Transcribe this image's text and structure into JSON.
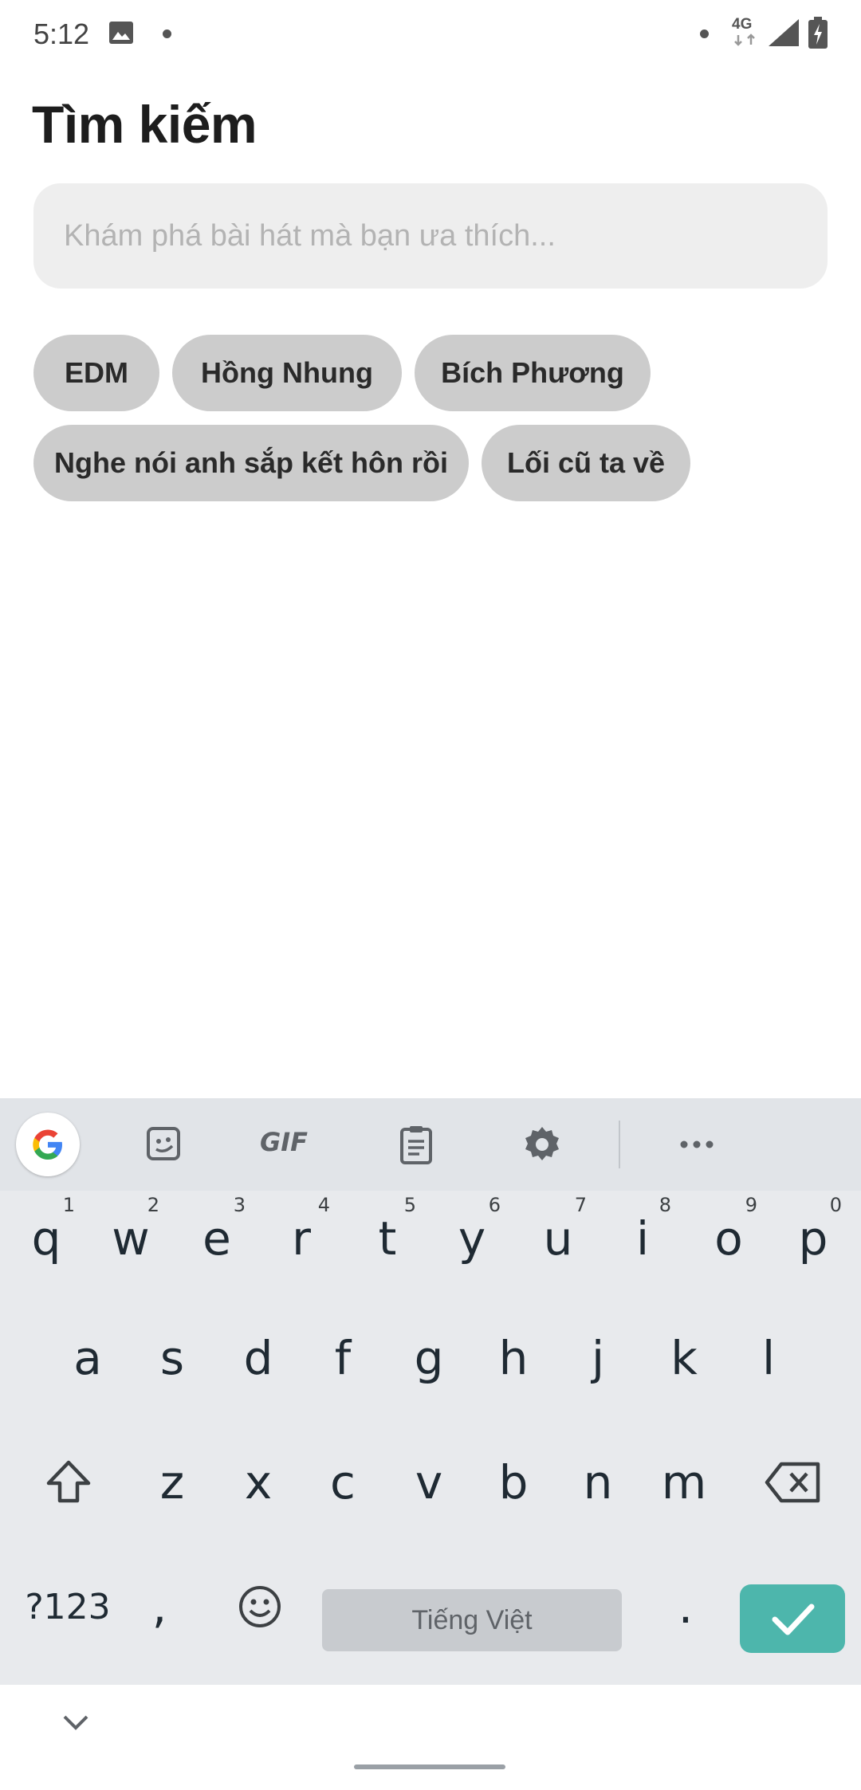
{
  "status_bar": {
    "time": "5:12",
    "network": "4G"
  },
  "header": {
    "title": "Tìm kiếm"
  },
  "search": {
    "placeholder": "Khám phá bài hát mà bạn ưa thích...",
    "value": ""
  },
  "chips": [
    {
      "label": "EDM"
    },
    {
      "label": "Hồng Nhung"
    },
    {
      "label": "Bích Phương"
    },
    {
      "label": "Nghe nói anh sắp kết hôn rồi"
    },
    {
      "label": "Lối cũ ta về"
    }
  ],
  "keyboard": {
    "toolbar_icons": [
      "google-icon",
      "sticker-icon",
      "gif-icon",
      "clipboard-icon",
      "settings-icon",
      "more-icon"
    ],
    "gif_label": "GIF",
    "row1": [
      "q",
      "w",
      "e",
      "r",
      "t",
      "y",
      "u",
      "i",
      "o",
      "p"
    ],
    "row1_hints": [
      "1",
      "2",
      "3",
      "4",
      "5",
      "6",
      "7",
      "8",
      "9",
      "0"
    ],
    "row2": [
      "a",
      "s",
      "d",
      "f",
      "g",
      "h",
      "j",
      "k",
      "l"
    ],
    "row3": [
      "z",
      "x",
      "c",
      "v",
      "b",
      "n",
      "m"
    ],
    "symbols_label": "?123",
    "comma": ",",
    "space_label": "Tiếng Việt",
    "period": ".",
    "enter_color": "#4db6ac"
  }
}
